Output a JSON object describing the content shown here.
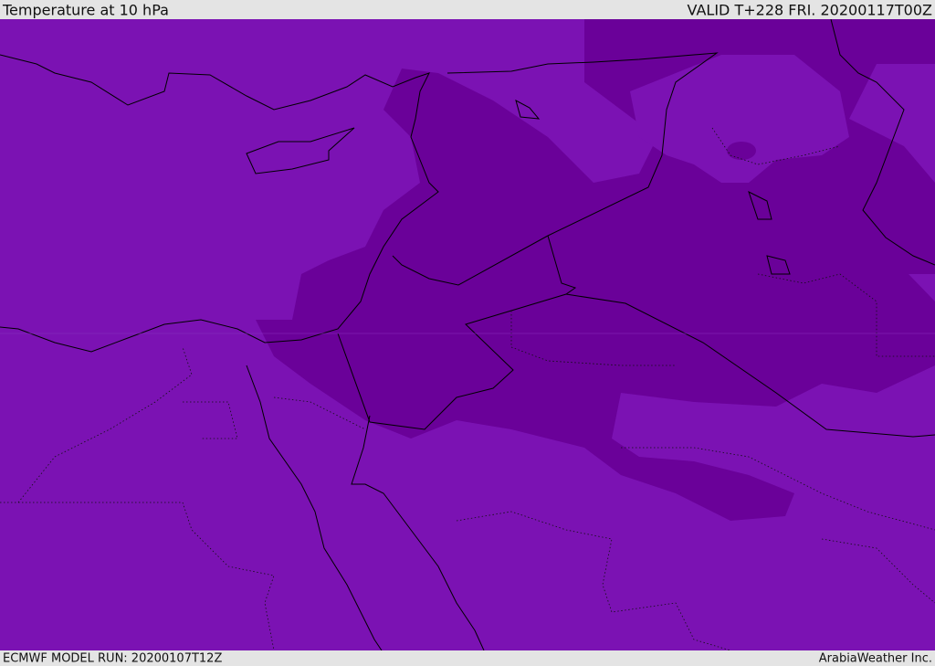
{
  "header": {
    "title": "Temperature at 10 hPa",
    "valid_time": "VALID T+228 FRI. 20200117T00Z"
  },
  "footer": {
    "model_run": "ECMWF MODEL RUN: 20200107T12Z",
    "credit": "ArabiaWeather Inc."
  },
  "colors": {
    "field_warm": "#7b12b3",
    "field_cold": "#6a0199",
    "coastline": "#000000",
    "background": "#e4e4e4"
  }
}
